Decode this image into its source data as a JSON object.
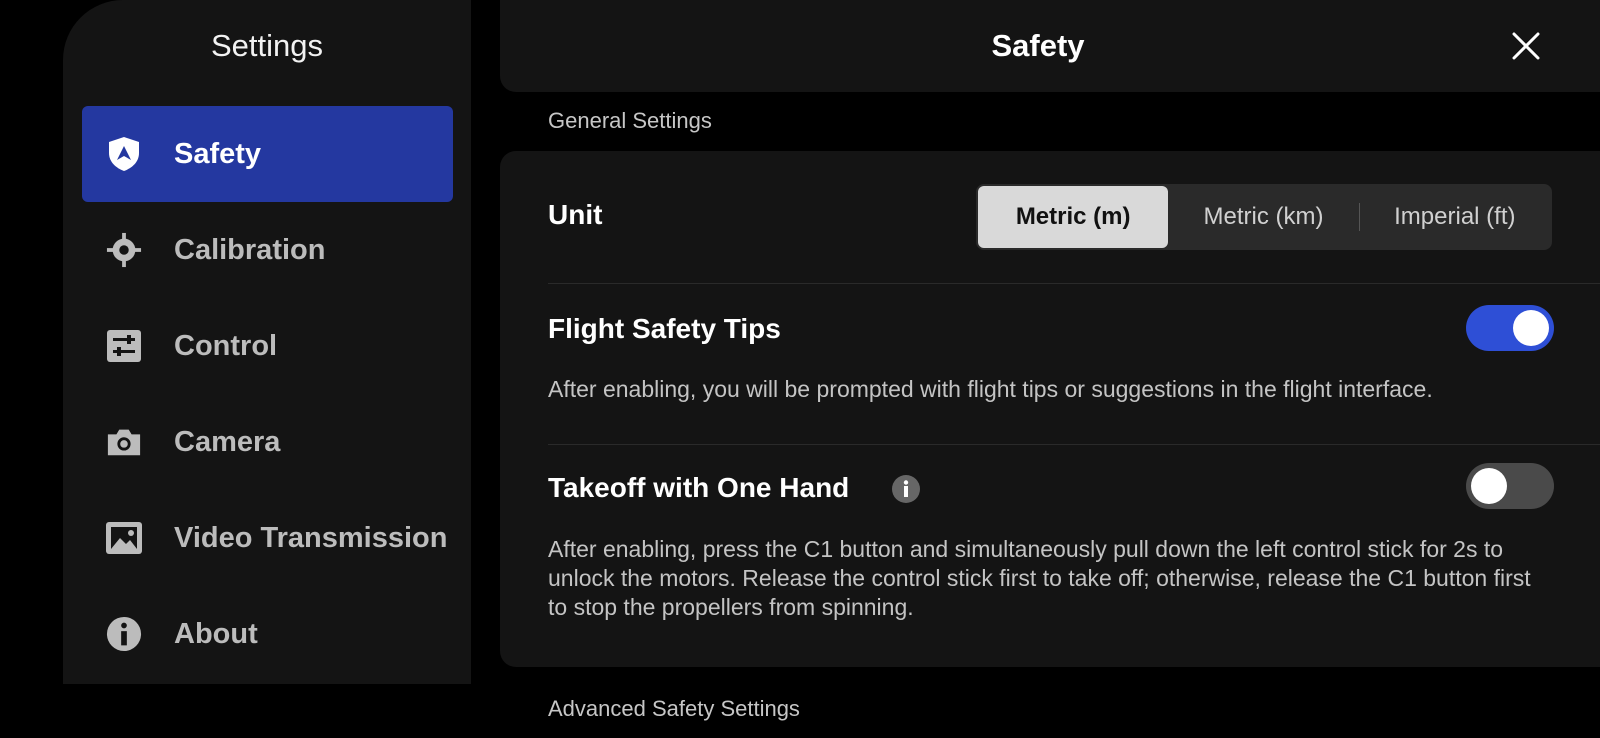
{
  "sidebar": {
    "title": "Settings",
    "items": [
      {
        "label": "Safety",
        "icon": "shield-icon",
        "active": true
      },
      {
        "label": "Calibration",
        "icon": "crosshair-icon",
        "active": false
      },
      {
        "label": "Control",
        "icon": "sliders-icon",
        "active": false
      },
      {
        "label": "Camera",
        "icon": "camera-icon",
        "active": false
      },
      {
        "label": "Video Transmission",
        "icon": "image-icon",
        "active": false
      },
      {
        "label": "About",
        "icon": "info-icon",
        "active": false
      }
    ]
  },
  "header": {
    "title": "Safety"
  },
  "sections": {
    "general": "General Settings",
    "advanced": "Advanced Safety Settings"
  },
  "unit": {
    "label": "Unit",
    "options": [
      "Metric (m)",
      "Metric (km)",
      "Imperial (ft)"
    ],
    "selected": "Metric (m)"
  },
  "flight_tips": {
    "title": "Flight Safety Tips",
    "description": "After enabling, you will be prompted with flight tips or suggestions in the flight interface.",
    "enabled": true
  },
  "one_hand": {
    "title": "Takeoff with One Hand",
    "description": "After enabling, press the C1 button and simultaneously pull down the left control stick for 2s to unlock the motors. Release the control stick first to take off; otherwise, release the C1 button first to stop the propellers from spinning.",
    "enabled": false
  },
  "colors": {
    "accent": "#2438a0",
    "toggle_on": "#2e4fd6"
  }
}
